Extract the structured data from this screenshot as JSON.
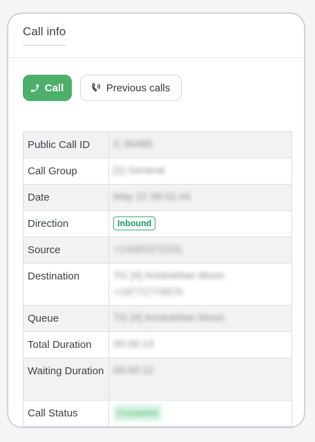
{
  "header": {
    "title": "Call info"
  },
  "actions": {
    "call_label": "Call",
    "call_icon": "phone-icon",
    "previous_calls_label": "Previous calls",
    "previous_calls_icon": "phone-ring-icon"
  },
  "colors": {
    "call_button": "#4caf6a",
    "badge": "#2eaa72"
  },
  "rows": [
    {
      "label": "Public Call ID",
      "value": "C.36485"
    },
    {
      "label": "Call Group",
      "value": "[1] General"
    },
    {
      "label": "Date",
      "value": "May 22 08:02:44"
    },
    {
      "label": "Direction",
      "value": "Inbound"
    },
    {
      "label": "Source",
      "value": "+14483372231"
    },
    {
      "label": "Destination",
      "value": "TG [4] Aristotelian Moon",
      "value2": "+18772779876"
    },
    {
      "label": "Queue",
      "value": "TG [4] Aristotelian Moon"
    },
    {
      "label": "Total Duration",
      "value": "00:00:13"
    },
    {
      "label": "Waiting Duration",
      "value": "00:00:12"
    },
    {
      "label": "Call Status",
      "value": "Completed"
    }
  ]
}
